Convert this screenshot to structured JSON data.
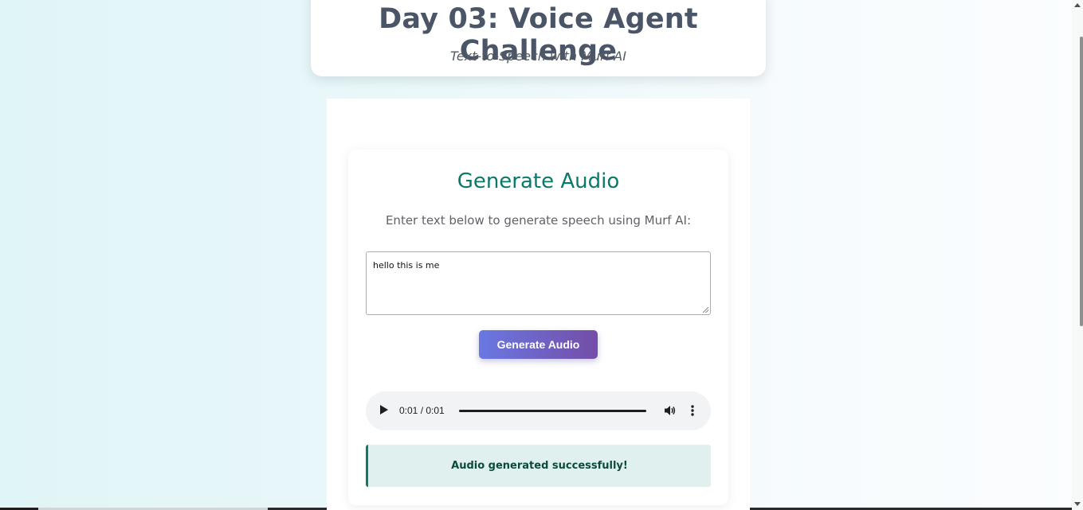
{
  "header": {
    "title": "Day 03: Voice Agent Challenge",
    "subtitle": "Text-to-Speech with Murf AI"
  },
  "tts": {
    "title": "Generate Audio",
    "instruction": "Enter text below to generate speech using Murf AI:",
    "input_value": "hello this is me",
    "button_label": "Generate Audio",
    "status_message": "Audio generated successfully!"
  },
  "audio_player": {
    "current_time": "0:01",
    "duration": "0:01",
    "time_display": "0:01 / 0:01",
    "progress": 1.0,
    "icons": [
      "play-icon",
      "volume-icon",
      "more-options-icon"
    ]
  },
  "colors": {
    "title_text": "#4a5568",
    "card_title": "#0a7a68",
    "button_gradient_start": "#6a78e2",
    "button_gradient_end": "#744da8",
    "success_background": "#dff0ef",
    "success_border": "#0f7a69",
    "success_text": "#0b4a3f"
  }
}
